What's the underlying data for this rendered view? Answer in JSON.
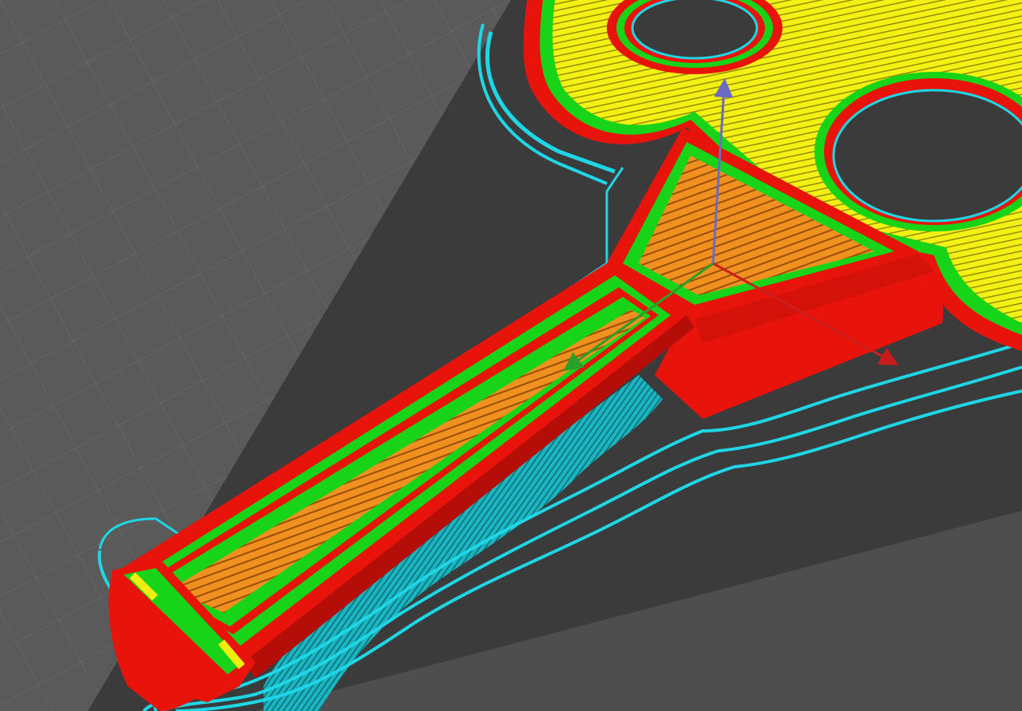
{
  "app": {
    "view": "slicer-layer-preview"
  },
  "colors": {
    "background": "#5a5a5a",
    "grid_line": "#6a6a6a",
    "build_plate_shadow": "#3a3a3a",
    "skirt_brim": "#1fd6e6",
    "outer_wall": "#e8140c",
    "inner_wall": "#18d418",
    "infill": "#f08a1c",
    "top_bottom_skin": "#f2ef10",
    "support": "#1fb8c4",
    "axis_x": "#cc2020",
    "axis_y": "#2aa02a",
    "axis_z": "#6b6bc4"
  },
  "icons": {
    "axis_x": "arrow-x-icon",
    "axis_y": "arrow-y-icon",
    "axis_z": "arrow-z-icon"
  }
}
